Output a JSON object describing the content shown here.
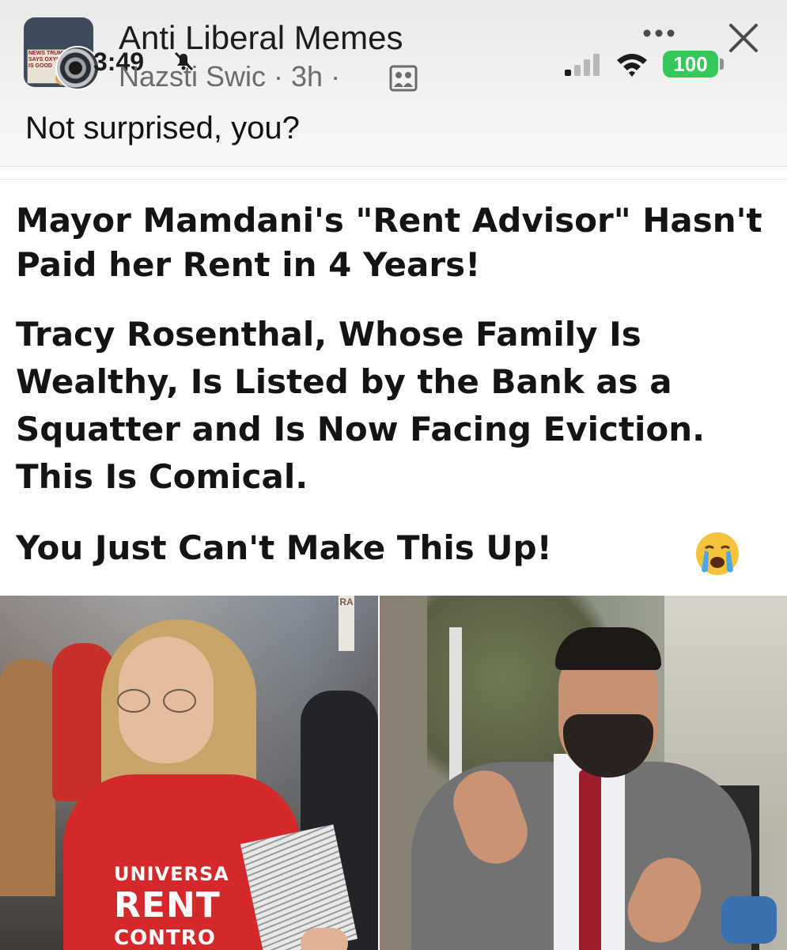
{
  "post_header": {
    "group_name": "Anti Liberal Memes",
    "time": "3:49",
    "author_meta": "Nazsti Swic · 3h ·",
    "group_avatar_text": "NEWS TRUMP SAYS OXYGEN IS GOOD",
    "battery": "100"
  },
  "post": {
    "caption": "Not surprised, you?"
  },
  "article": {
    "headline": "Mayor Mamdani's \"Rent Advisor\" Hasn't Paid her Rent in 4 Years!",
    "subhead": "Tracy Rosenthal, Whose Family Is Wealthy, Is Listed by the Bank as a Squatter and Is Now Facing Eviction. This Is Comical.",
    "tagline": "You Just Can't Make This Up!",
    "emoji": "crying-face-icon",
    "shirt_line1": "UNIVERSA",
    "shirt_line2": "RENT",
    "shirt_line3": "CONTRO",
    "sign_partial": "RA"
  },
  "colors": {
    "battery_green": "#34c759",
    "shirt_red": "#d5282b",
    "tie_red": "#9e1b2c"
  }
}
